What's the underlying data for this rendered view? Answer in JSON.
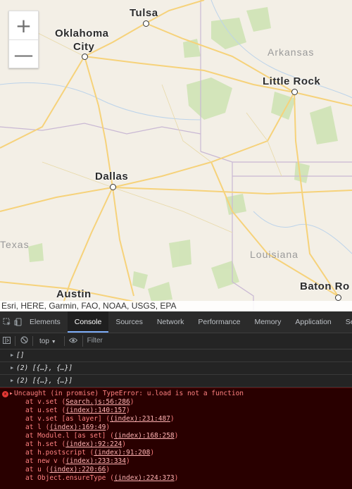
{
  "map": {
    "zoom_in": "+",
    "zoom_out": "—",
    "cities": {
      "tulsa": "Tulsa",
      "okc_line1": "Oklahoma",
      "okc_line2": "City",
      "little_rock": "Little Rock",
      "dallas": "Dallas",
      "austin": "Austin",
      "baton_rouge": "Baton Ro"
    },
    "states": {
      "arkansas": "Arkansas",
      "texas": "Texas",
      "louisiana": "Louisiana"
    },
    "attribution": "Esri, HERE, Garmin, FAO, NOAA, USGS, EPA"
  },
  "devtools": {
    "tabs": [
      "Elements",
      "Console",
      "Sources",
      "Network",
      "Performance",
      "Memory",
      "Application",
      "Secu"
    ],
    "active_tab": "Console",
    "context": "top",
    "filter_placeholder": "Filter",
    "logs": [
      "[]",
      "(2) [{…}, {…}]",
      "(2) [{…}, {…}]"
    ],
    "error": {
      "message": "Uncaught (in promise) TypeError: u.load is not a function",
      "frames": [
        {
          "fn": "at v.set (",
          "loc": "Search.js:56:286",
          "end": ")"
        },
        {
          "fn": "at u.set (",
          "loc": "(index):140:157",
          "end": ")"
        },
        {
          "fn": "at v.set [as layer] (",
          "loc": "(index):231:487",
          "end": ")"
        },
        {
          "fn": "at l (",
          "loc": "(index):169:49",
          "end": ")"
        },
        {
          "fn": "at Module.l [as set] (",
          "loc": "(index):168:258",
          "end": ")"
        },
        {
          "fn": "at h.set (",
          "loc": "(index):92:224",
          "end": ")"
        },
        {
          "fn": "at h.postscript (",
          "loc": "(index):91:208",
          "end": ")"
        },
        {
          "fn": "at new v (",
          "loc": "(index):233:334",
          "end": ")"
        },
        {
          "fn": "at u (",
          "loc": "(index):220:66",
          "end": ")"
        },
        {
          "fn": "at Object.ensureType (",
          "loc": "(index):224:373",
          "end": ")"
        }
      ]
    }
  }
}
